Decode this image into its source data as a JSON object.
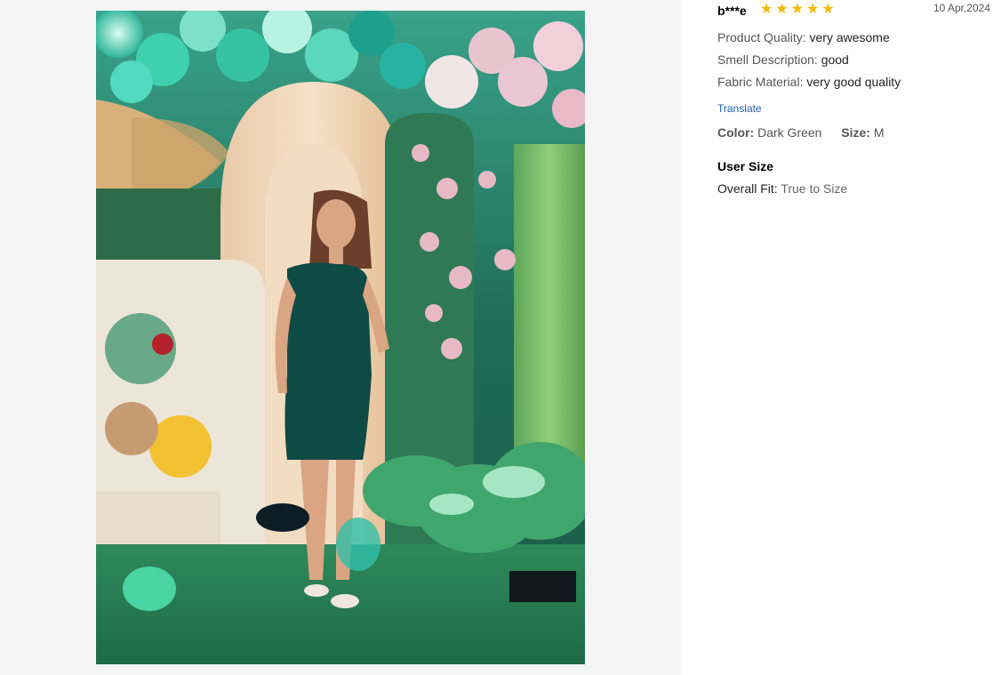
{
  "photo": {
    "description_icon": "review-photo-icon"
  },
  "review": {
    "username": "b***e",
    "rating": 5,
    "star_glyph": "★",
    "date": "10 Apr,2024",
    "attributes": [
      {
        "label": "Product Quality: ",
        "value": "very awesome"
      },
      {
        "label": "Smell Description: ",
        "value": "good"
      },
      {
        "label": "Fabric Material: ",
        "value": "very good quality"
      }
    ],
    "translate_label": "Translate",
    "color_label": "Color:",
    "color_value": "Dark Green",
    "size_label": "Size:",
    "size_value": "M",
    "user_size_title": "User Size",
    "fit_label": "Overall Fit: ",
    "fit_value": "True to Size"
  },
  "colors": {
    "star": "#f5b800",
    "link": "#1a5fb4",
    "panel_bg": "#f5f5f5"
  }
}
